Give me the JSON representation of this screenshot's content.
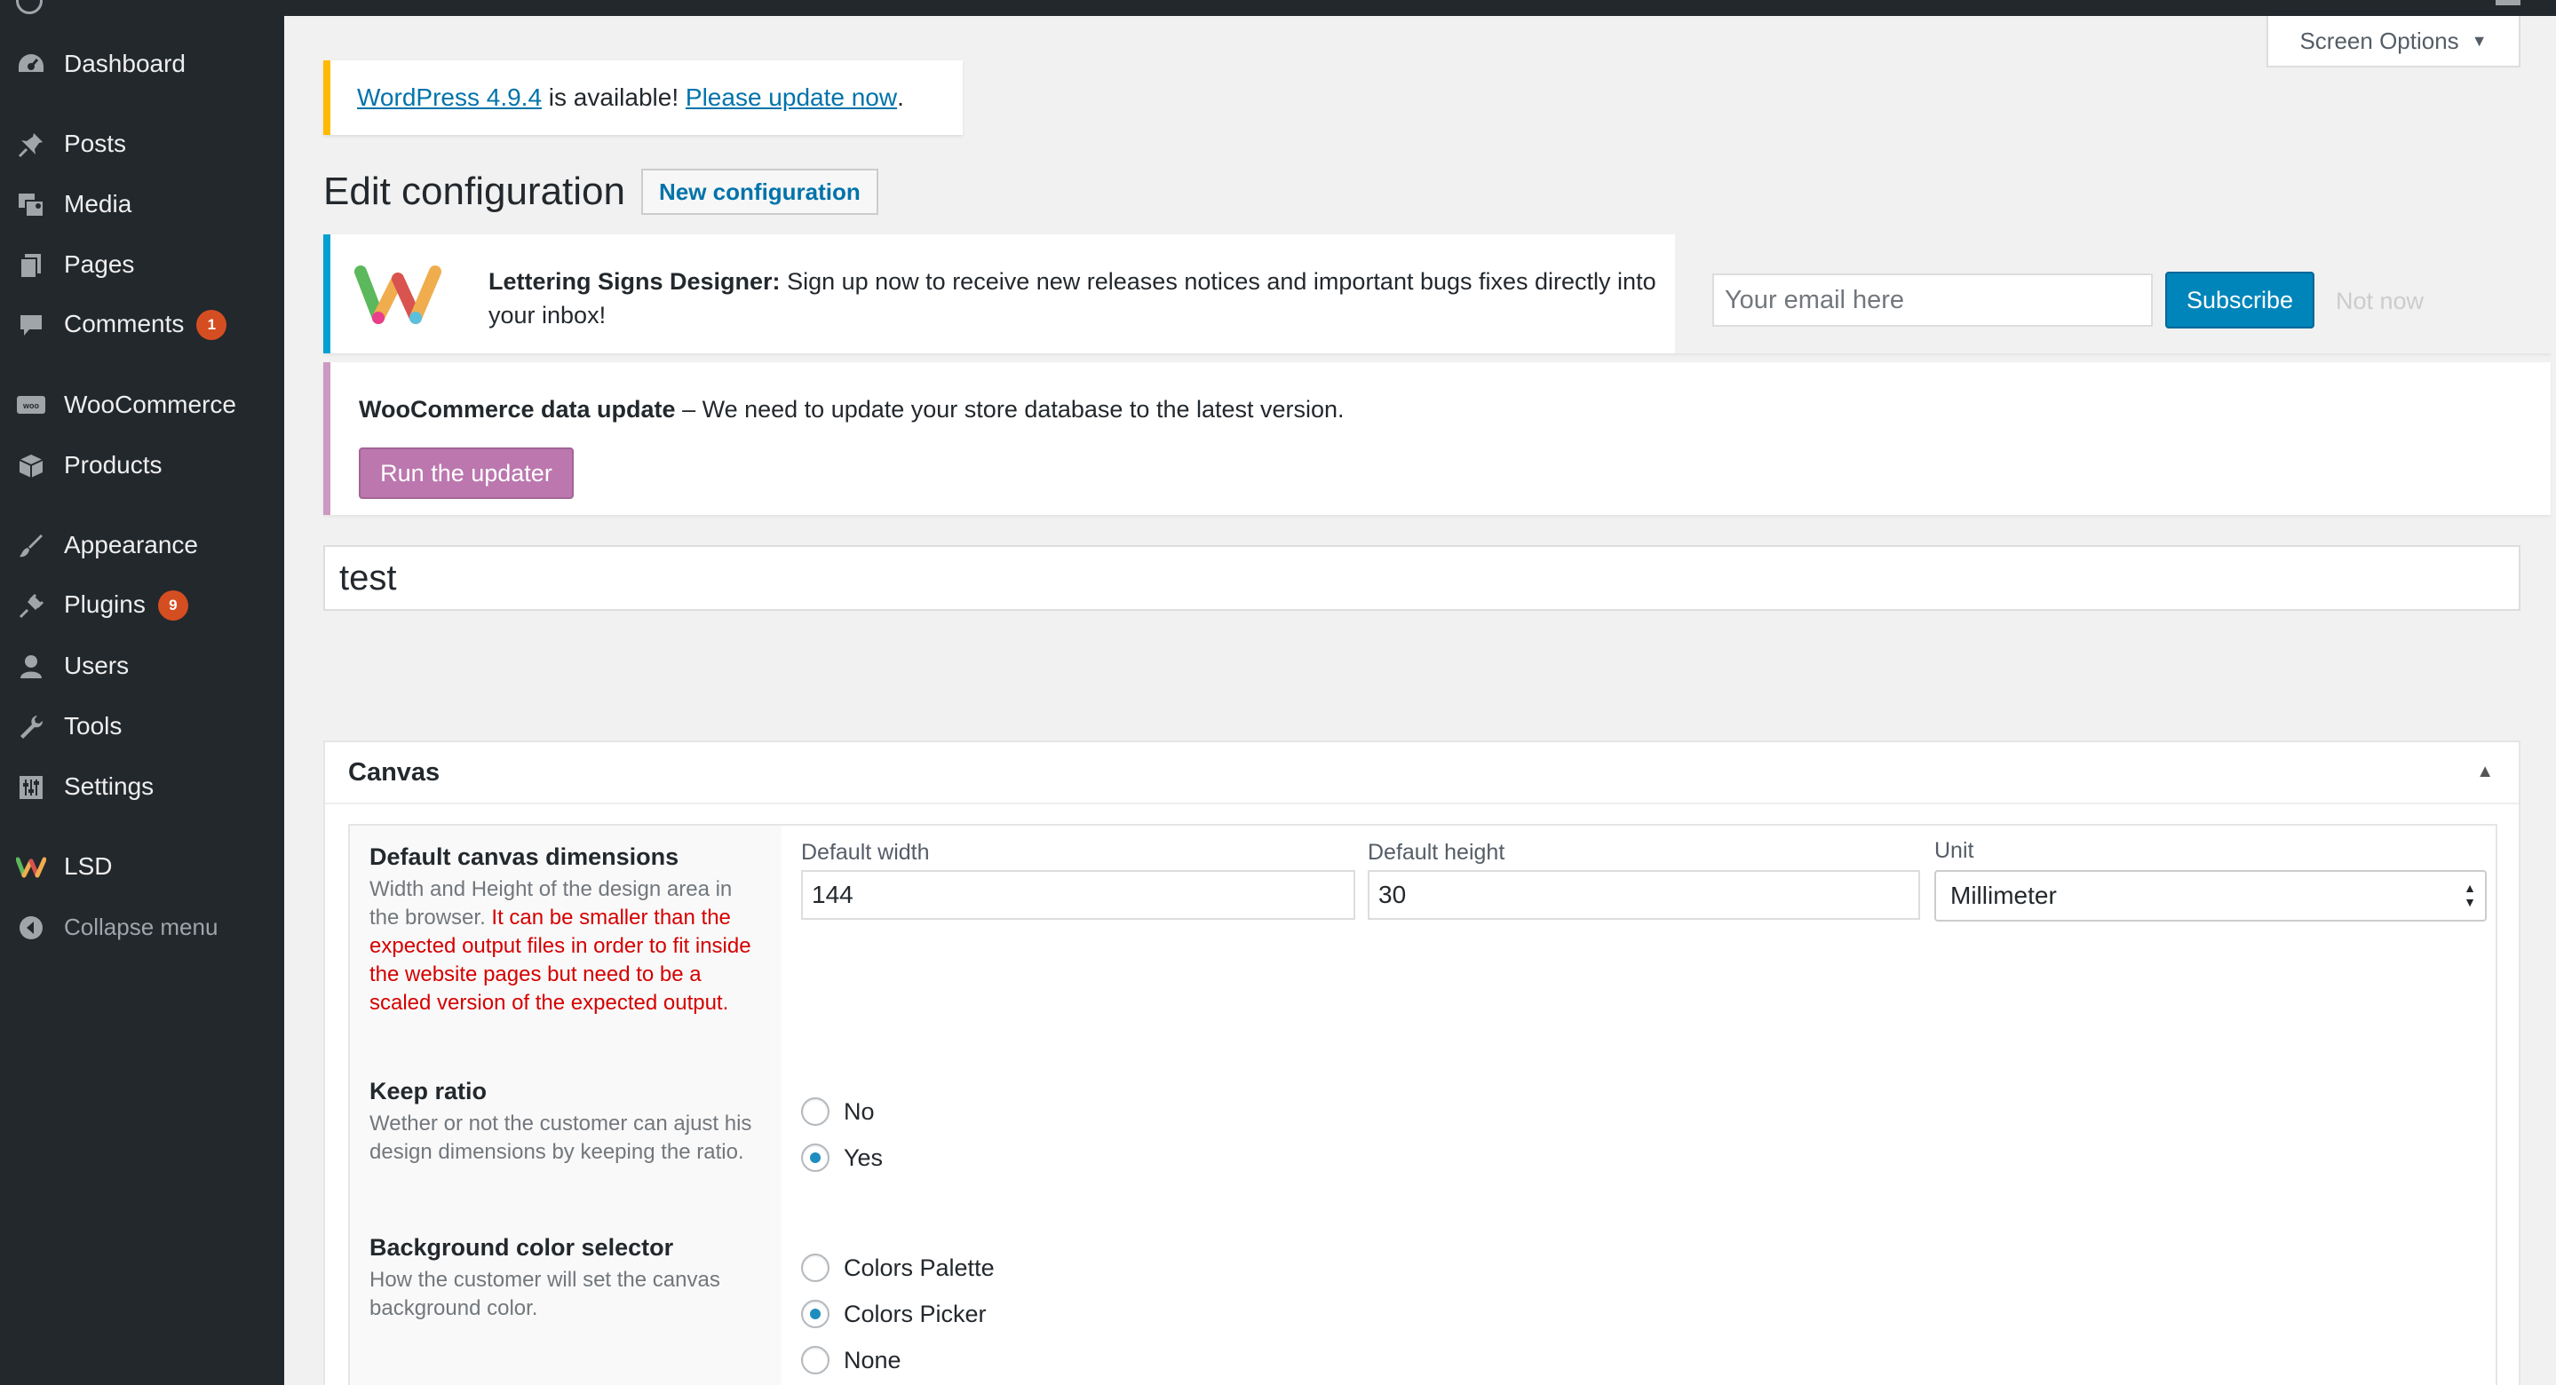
{
  "sidebar": {
    "items": [
      {
        "label": "Dashboard",
        "icon": "dashboard-icon"
      },
      {
        "label": "Posts",
        "icon": "pushpin-icon"
      },
      {
        "label": "Media",
        "icon": "media-icon"
      },
      {
        "label": "Pages",
        "icon": "pages-icon"
      },
      {
        "label": "Comments",
        "icon": "comment-icon",
        "count": "1"
      },
      {
        "label": "WooCommerce",
        "icon": "woocommerce-icon"
      },
      {
        "label": "Products",
        "icon": "box-icon"
      },
      {
        "label": "Appearance",
        "icon": "paintbrush-icon"
      },
      {
        "label": "Plugins",
        "icon": "plugin-icon",
        "count": "9"
      },
      {
        "label": "Users",
        "icon": "user-icon"
      },
      {
        "label": "Tools",
        "icon": "wrench-icon"
      },
      {
        "label": "Settings",
        "icon": "settings-icon"
      },
      {
        "label": "LSD",
        "icon": "lsd-logo-icon"
      },
      {
        "label": "Collapse menu",
        "icon": "collapse-arrow-icon"
      }
    ]
  },
  "screen_options": {
    "label": "Screen Options"
  },
  "update_nag": {
    "version_link": "WordPress 4.9.4",
    "middle_text": " is available! ",
    "update_link": "Please update now",
    "end_text": "."
  },
  "heading": {
    "title": "Edit configuration",
    "new_button": "New configuration"
  },
  "lsd_notice": {
    "brand": "Lettering Signs Designer:",
    "message": " Sign up now to receive new releases notices and important bugs fixes directly into your inbox!",
    "email_placeholder": "Your email here",
    "subscribe": "Subscribe",
    "not_now": "Not now"
  },
  "woo_notice": {
    "title": "WooCommerce data update",
    "message": " – We need to update your store database to the latest version.",
    "button": "Run the updater"
  },
  "config_title": "test",
  "canvas": {
    "title": "Canvas",
    "dimensions": {
      "title": "Default canvas dimensions",
      "desc_gray": "Width and Height of the design area in the browser. ",
      "desc_red": "It can be smaller than the expected output files in order to fit inside the website pages but need to be a scaled version of the expected output.",
      "width_label": "Default width",
      "width_value": "144",
      "height_label": "Default height",
      "height_value": "30",
      "unit_label": "Unit",
      "unit_value": "Millimeter"
    },
    "keep_ratio": {
      "title": "Keep ratio",
      "desc": "Wether or not the customer can ajust his design dimensions by keeping the ratio.",
      "options": [
        "No",
        "Yes"
      ],
      "selected": "Yes"
    },
    "bg_selector": {
      "title": "Background color selector",
      "desc": "How the customer will set the canvas background color.",
      "options": [
        "Colors Palette",
        "Colors Picker",
        "None"
      ],
      "selected": "Colors Picker"
    }
  },
  "colors": {
    "sidebar_bg": "#23282d",
    "accent": "#0085ba",
    "badge": "#d54e21",
    "woo_purple": "#bb77ae",
    "warning_yellow": "#ffb900",
    "notice_blue": "#00a0d2",
    "desc_red": "#d50000"
  }
}
